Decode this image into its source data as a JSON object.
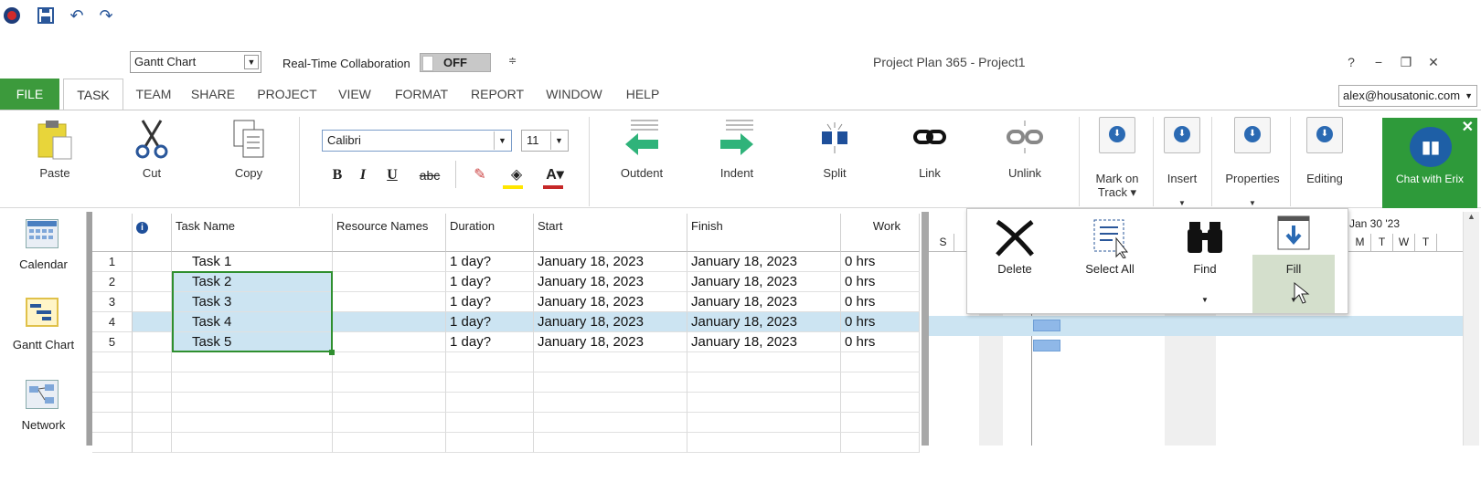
{
  "titlebar": {
    "view_select": "Gantt Chart",
    "collab_label": "Real-Time Collaboration",
    "collab_state": "OFF",
    "app_title": "Project Plan 365 - Project1",
    "help_glyph": "?",
    "minimize_glyph": "−",
    "restore_glyph": "❐",
    "close_glyph": "✕"
  },
  "tabs": [
    "FILE",
    "TASK",
    "TEAM",
    "SHARE",
    "PROJECT",
    "VIEW",
    "FORMAT",
    "REPORT",
    "WINDOW",
    "HELP"
  ],
  "account": "alex@housatonic.com",
  "ribbon": {
    "paste": "Paste",
    "cut": "Cut",
    "copy": "Copy",
    "font": "Calibri",
    "size": "11",
    "bold": "B",
    "italic": "I",
    "underline": "U",
    "strike": "abc",
    "outdent": "Outdent",
    "indent": "Indent",
    "split": "Split",
    "link": "Link",
    "unlink": "Unlink",
    "mark_on_track": "Mark on",
    "mark_on_track_2": "Track ▾",
    "insert": "Insert",
    "properties": "Properties",
    "editing": "Editing",
    "chat": "Chat with Erix"
  },
  "nav": {
    "calendar": "Calendar",
    "gantt": "Gantt Chart",
    "network": "Network"
  },
  "grid": {
    "headers": {
      "info": "i",
      "task_name": "Task Name",
      "resource_names": "Resource Names",
      "duration": "Duration",
      "start": "Start",
      "finish": "Finish",
      "work": "Work"
    },
    "rows": [
      {
        "n": "1",
        "name": "Task 1",
        "duration": "1 day?",
        "start": "January 18, 2023",
        "finish": "January 18, 2023",
        "work": "0 hrs"
      },
      {
        "n": "2",
        "name": "Task 2",
        "duration": "1 day?",
        "start": "January 18, 2023",
        "finish": "January 18, 2023",
        "work": "0 hrs"
      },
      {
        "n": "3",
        "name": "Task 3",
        "duration": "1 day?",
        "start": "January 18, 2023",
        "finish": "January 18, 2023",
        "work": "0 hrs"
      },
      {
        "n": "4",
        "name": "Task 4",
        "duration": "1 day?",
        "start": "January 18, 2023",
        "finish": "January 18, 2023",
        "work": "0 hrs"
      },
      {
        "n": "5",
        "name": "Task 5",
        "duration": "1 day?",
        "start": "January 18, 2023",
        "finish": "January 18, 2023",
        "work": "0 hrs"
      }
    ]
  },
  "gantt": {
    "week_label": "Jan 30 '23",
    "days_left": [
      "S"
    ],
    "days_right": [
      "M",
      "T",
      "W",
      "T"
    ]
  },
  "editing_popup": {
    "delete": "Delete",
    "select_all": "Select All",
    "find": "Find",
    "fill": "Fill"
  },
  "colors": {
    "accent": "#3c9a3c",
    "selection": "#cce4f2",
    "bar": "#8fb8e8"
  }
}
